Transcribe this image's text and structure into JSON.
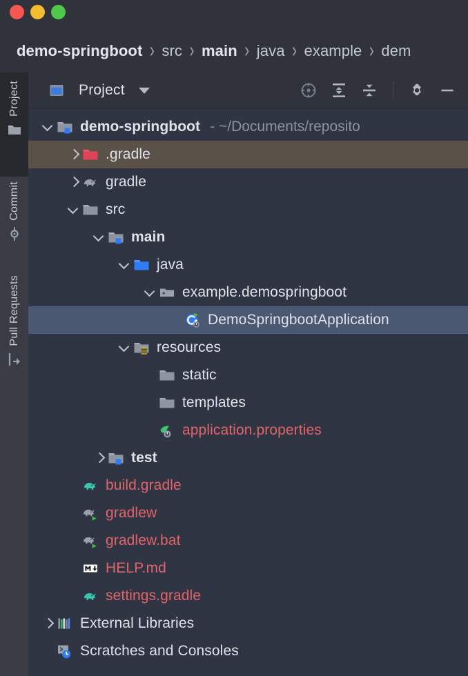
{
  "window": {
    "traffic_lights": [
      {
        "name": "close",
        "color": "#f6584f"
      },
      {
        "name": "minimize",
        "color": "#f6bc2f"
      },
      {
        "name": "zoom",
        "color": "#4fc94c"
      }
    ]
  },
  "breadcrumb": {
    "separator": "›",
    "items": [
      {
        "label": "demo-springboot",
        "bold": true
      },
      {
        "label": "src",
        "bold": false
      },
      {
        "label": "main",
        "bold": true
      },
      {
        "label": "java",
        "bold": false
      },
      {
        "label": "example",
        "bold": false
      },
      {
        "label": "dem",
        "bold": false
      }
    ]
  },
  "tool_stripe": {
    "items": [
      {
        "id": "project",
        "label": "Project",
        "icon": "folder-icon",
        "active": true
      },
      {
        "id": "commit",
        "label": "Commit",
        "icon": "commit-icon",
        "active": false
      },
      {
        "id": "pull_requests",
        "label": "Pull Requests",
        "icon": "pull-request-icon",
        "active": false
      }
    ]
  },
  "panel": {
    "title": "Project",
    "view_dropdown_icon": "chevron-down-icon",
    "actions": [
      {
        "id": "select_opened_file",
        "icon": "target-icon",
        "tooltip": "Select Opened File"
      },
      {
        "id": "expand_all",
        "icon": "expand-all-icon",
        "tooltip": "Expand All"
      },
      {
        "id": "collapse_all",
        "icon": "collapse-all-icon",
        "tooltip": "Collapse All"
      },
      {
        "id": "options",
        "icon": "gear-icon",
        "tooltip": "Options"
      },
      {
        "id": "hide",
        "icon": "minimize-icon",
        "tooltip": "Hide"
      }
    ]
  },
  "tree": {
    "rows": [
      {
        "indent": 0,
        "arrow": "open",
        "icon": "module-folder-icon",
        "label": "demo-springboot",
        "bold": true,
        "color": "default",
        "sublabel": "- ~/Documents/reposito",
        "state": "normal"
      },
      {
        "indent": 1,
        "arrow": "closed",
        "icon": "red-folder-icon",
        "label": ".gradle",
        "bold": false,
        "color": "default",
        "sublabel": "",
        "state": "hover"
      },
      {
        "indent": 1,
        "arrow": "closed",
        "icon": "gradle-elephant-grey-icon",
        "label": "gradle",
        "bold": false,
        "color": "default",
        "sublabel": "",
        "state": "normal"
      },
      {
        "indent": 1,
        "arrow": "open",
        "icon": "folder-icon",
        "label": "src",
        "bold": false,
        "color": "default",
        "sublabel": "",
        "state": "normal"
      },
      {
        "indent": 2,
        "arrow": "open",
        "icon": "module-folder-icon",
        "label": "main",
        "bold": true,
        "color": "default",
        "sublabel": "",
        "state": "normal"
      },
      {
        "indent": 3,
        "arrow": "open",
        "icon": "source-root-icon",
        "label": "java",
        "bold": false,
        "color": "default",
        "sublabel": "",
        "state": "normal"
      },
      {
        "indent": 4,
        "arrow": "open",
        "icon": "package-icon",
        "label": "example.demospringboot",
        "bold": false,
        "color": "default",
        "sublabel": "",
        "state": "normal"
      },
      {
        "indent": 5,
        "arrow": "none",
        "icon": "spring-class-run-icon",
        "label": "DemoSpringbootApplication",
        "bold": false,
        "color": "default",
        "sublabel": "",
        "state": "selected"
      },
      {
        "indent": 3,
        "arrow": "open",
        "icon": "resources-root-icon",
        "label": "resources",
        "bold": false,
        "color": "default",
        "sublabel": "",
        "state": "normal"
      },
      {
        "indent": 4,
        "arrow": "none",
        "icon": "folder-icon",
        "label": "static",
        "bold": false,
        "color": "default",
        "sublabel": "",
        "state": "normal"
      },
      {
        "indent": 4,
        "arrow": "none",
        "icon": "folder-icon",
        "label": "templates",
        "bold": false,
        "color": "default",
        "sublabel": "",
        "state": "normal"
      },
      {
        "indent": 4,
        "arrow": "none",
        "icon": "spring-properties-icon",
        "label": "application.properties",
        "bold": false,
        "color": "red",
        "sublabel": "",
        "state": "normal"
      },
      {
        "indent": 2,
        "arrow": "closed",
        "icon": "test-root-icon",
        "label": "test",
        "bold": true,
        "color": "default",
        "sublabel": "",
        "state": "normal"
      },
      {
        "indent": 1,
        "arrow": "none",
        "icon": "gradle-elephant-green-icon",
        "label": "build.gradle",
        "bold": false,
        "color": "red",
        "sublabel": "",
        "state": "normal"
      },
      {
        "indent": 1,
        "arrow": "none",
        "icon": "gradle-elephant-run-icon",
        "label": "gradlew",
        "bold": false,
        "color": "red",
        "sublabel": "",
        "state": "normal"
      },
      {
        "indent": 1,
        "arrow": "none",
        "icon": "gradle-elephant-run-icon",
        "label": "gradlew.bat",
        "bold": false,
        "color": "red",
        "sublabel": "",
        "state": "normal"
      },
      {
        "indent": 1,
        "arrow": "none",
        "icon": "markdown-icon",
        "label": "HELP.md",
        "bold": false,
        "color": "red",
        "sublabel": "",
        "state": "normal"
      },
      {
        "indent": 1,
        "arrow": "none",
        "icon": "gradle-elephant-green-icon",
        "label": "settings.gradle",
        "bold": false,
        "color": "red",
        "sublabel": "",
        "state": "normal"
      },
      {
        "indent": 0,
        "arrow": "closed",
        "icon": "external-libraries-icon",
        "label": "External Libraries",
        "bold": false,
        "color": "default",
        "sublabel": "",
        "state": "normal"
      },
      {
        "indent": 0,
        "arrow": "none",
        "icon": "scratches-icon",
        "label": "Scratches and Consoles",
        "bold": false,
        "color": "default",
        "sublabel": "",
        "state": "normal"
      }
    ]
  },
  "colors": {
    "background": "#2f3543",
    "titlebar": "#30333b",
    "stripe": "#393c44",
    "stripe_active": "#27292e",
    "selection": "#4a5871",
    "hover": "#5a5248",
    "text": "#dfe2e8",
    "muted_text": "#8b919d",
    "unversioned_red": "#e0646a",
    "source_blue": "#3b7ddd"
  }
}
